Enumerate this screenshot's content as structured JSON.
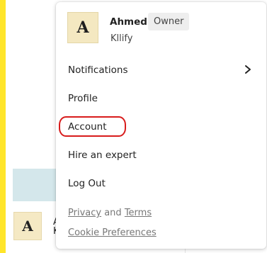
{
  "background": {
    "accent_color": "#ffe52a",
    "highlight_color": "#d4e7eb",
    "avatar_letter": "A",
    "name_fragment_1": "A",
    "name_fragment_2": "K"
  },
  "menu": {
    "avatar_letter": "A",
    "user_name": "Ahmed",
    "role_badge": "Owner",
    "org_name": "Kllify",
    "items": [
      {
        "label": "Notifications",
        "icon": "chevron-right-icon"
      },
      {
        "label": "Profile"
      },
      {
        "label": "Account"
      },
      {
        "label": "Hire an expert"
      },
      {
        "label": "Log Out"
      }
    ],
    "footer": {
      "privacy": "Privacy",
      "and": "and",
      "terms": "Terms",
      "cookie": "Cookie Preferences"
    },
    "annotation_color": "#d81c1c"
  }
}
